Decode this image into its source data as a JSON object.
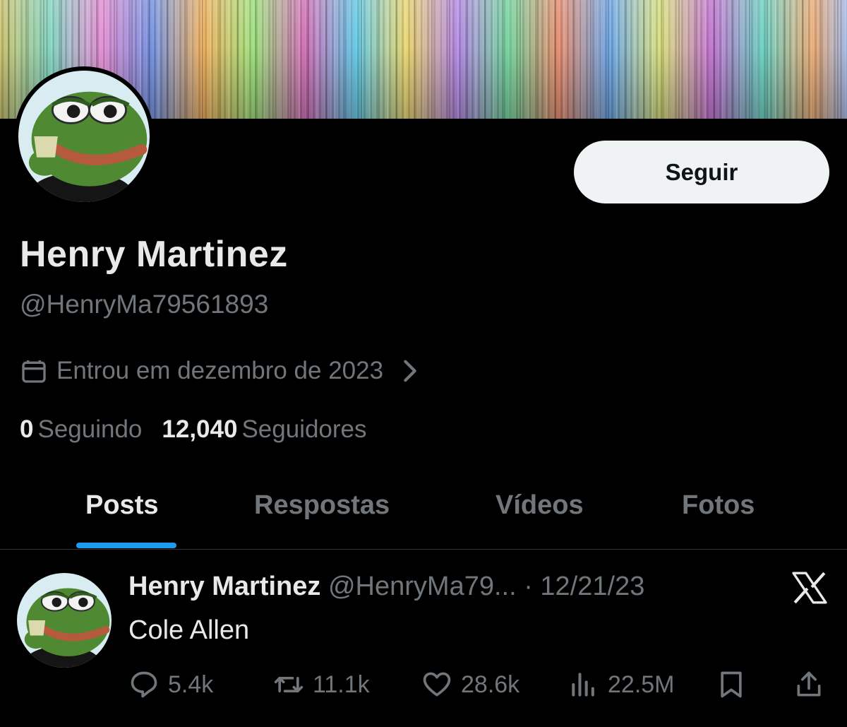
{
  "profile": {
    "display_name": "Henry Martinez",
    "handle": "@HenryMa79561893",
    "joined": "Entrou em dezembro de 2023",
    "follow_label": "Seguir",
    "following_count": "0",
    "following_label": "Seguindo",
    "followers_count": "12,040",
    "followers_label": "Seguidores"
  },
  "tabs": [
    {
      "label": "Posts",
      "active": true
    },
    {
      "label": "Respostas",
      "active": false
    },
    {
      "label": "Vídeos",
      "active": false
    },
    {
      "label": "Fotos",
      "active": false
    }
  ],
  "post": {
    "name": "Henry Martinez",
    "handle": "@HenryMa79...",
    "separator": "·",
    "date": "12/21/23",
    "text": "Cole Allen",
    "replies": "5.4k",
    "reposts": "11.1k",
    "likes": "28.6k",
    "views": "22.5M"
  },
  "icons": {
    "calendar": "calendar-icon",
    "chevron": "chevron-right-icon",
    "x_logo": "x-logo-icon",
    "reply": "reply-icon",
    "repost": "repost-icon",
    "like": "heart-icon",
    "views": "views-icon",
    "bookmark": "bookmark-icon",
    "share": "share-icon"
  },
  "colors": {
    "background": "#000000",
    "text_primary": "#e7e9ea",
    "text_secondary": "#71767b",
    "accent": "#1d9bf0",
    "button_bg": "#eff3f4"
  }
}
